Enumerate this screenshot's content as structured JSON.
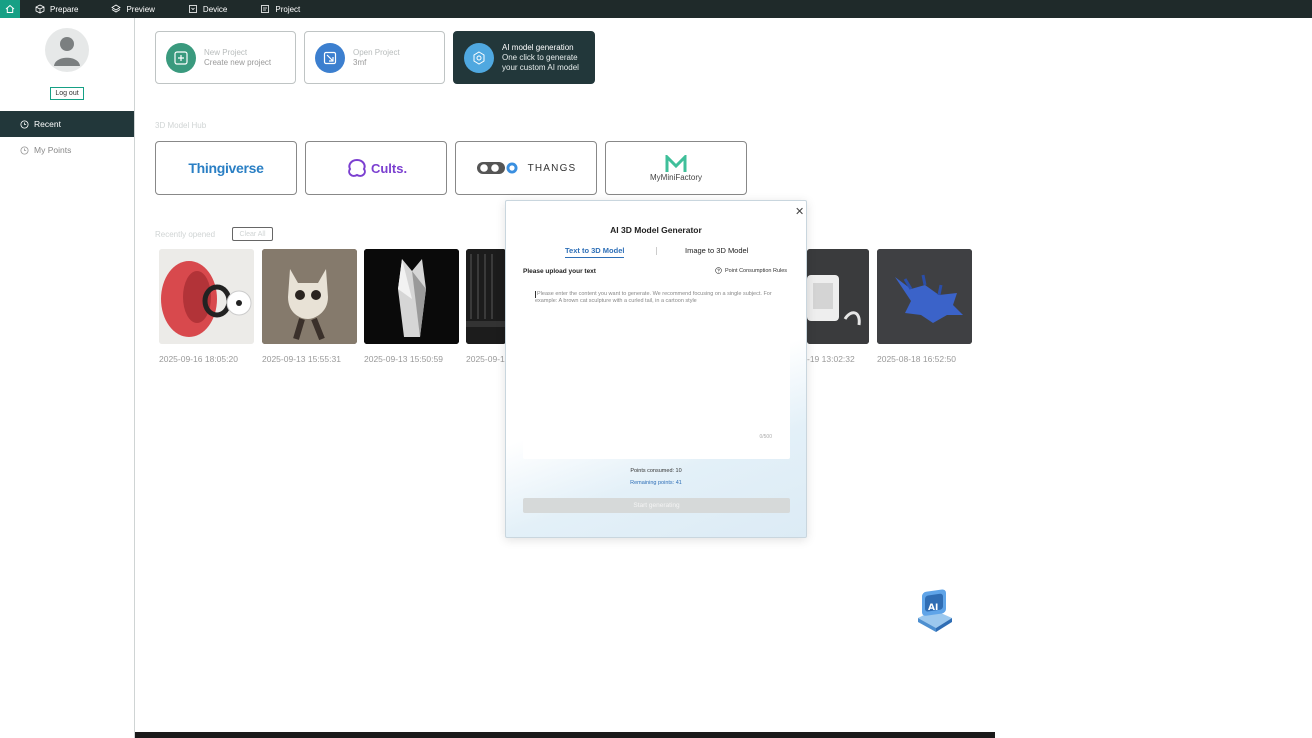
{
  "topnav": {
    "items": [
      {
        "label": "Prepare",
        "icon": "cube-icon"
      },
      {
        "label": "Preview",
        "icon": "layers-icon"
      },
      {
        "label": "Device",
        "icon": "device-icon"
      },
      {
        "label": "Project",
        "icon": "project-icon"
      }
    ]
  },
  "sidebar": {
    "logout_label": "Log out",
    "items": [
      {
        "label": "Recent",
        "icon": "clock-icon",
        "active": true
      },
      {
        "label": "My Points",
        "icon": "clock-icon",
        "active": false
      }
    ]
  },
  "cards": [
    {
      "title": "New Project",
      "subtitle": "Create new project",
      "icon": "new-project-icon"
    },
    {
      "title": "Open Project",
      "subtitle": "3mf",
      "icon": "open-project-icon"
    },
    {
      "title": "AI model generation",
      "subtitle": "One click to generate your custom AI model",
      "icon": "ai-gear-icon"
    }
  ],
  "hub": {
    "label": "3D Model Hub",
    "sites": [
      "Thingiverse",
      "Cults.",
      "THANGS",
      "MyMiniFactory"
    ]
  },
  "recent": {
    "label": "Recently opened",
    "clear_label": "Clear All",
    "dates": [
      "2025-09-16 18:05:20",
      "2025-09-13 15:55:31",
      "2025-09-13 15:50:59",
      "2025-09-1",
      "-19 13:02:32",
      "2025-08-18 16:52:50"
    ]
  },
  "dialog": {
    "title": "AI 3D Model Generator",
    "tabs": [
      "Text to 3D Model",
      "Image to 3D Model"
    ],
    "upload_label": "Please upload your text",
    "rules_label": "Point Consumption Rules",
    "placeholder": "Please enter the content you want to generate. We recommend focusing on a single subject. For example: A brown cat sculpture with a curled tail, in a cartoon style",
    "counter": "0/500",
    "points_consumed": "Points consumed:  10",
    "remaining_points": "Remaining points:  41",
    "start_label": "Start generating"
  },
  "colors": {
    "accent": "#16a085",
    "dark": "#22373a",
    "link": "#2e6fb7"
  }
}
